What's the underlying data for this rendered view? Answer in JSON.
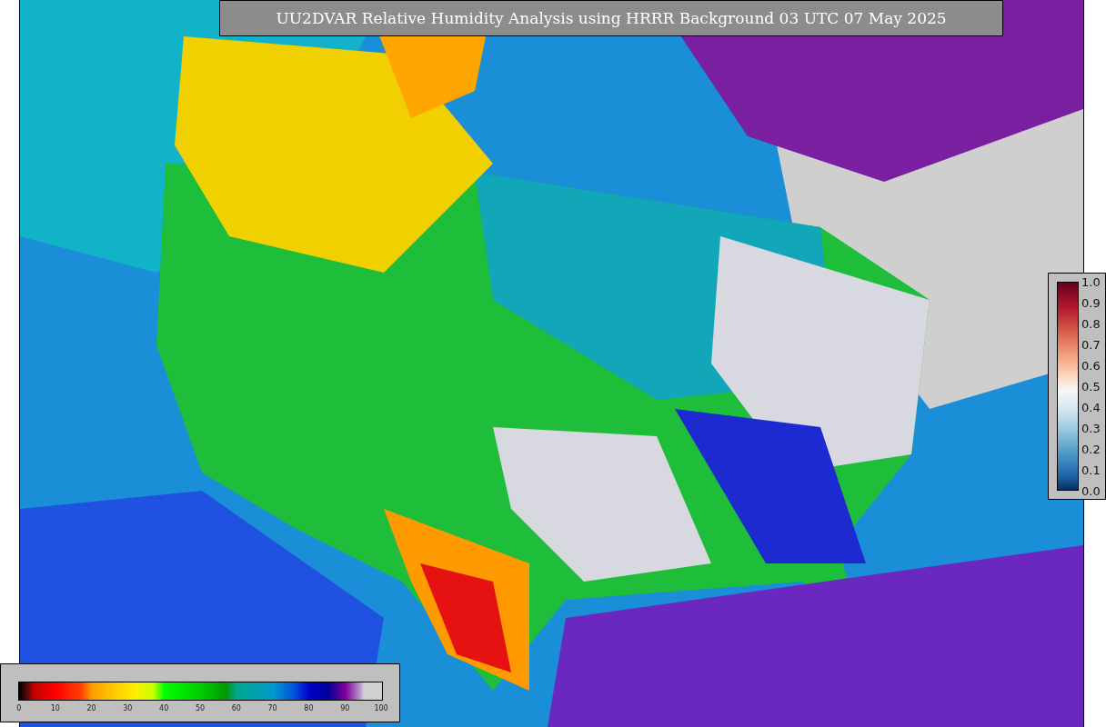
{
  "title": "UU2DVAR Relative Humidity Analysis using HRRR Background 03 UTC 07 May 2025",
  "observation_colorbar": {
    "ticks": [
      "1.0",
      "0.9",
      "0.8",
      "0.7",
      "0.6",
      "0.5",
      "0.4",
      "0.3",
      "0.2",
      "0.1",
      "0.0"
    ]
  },
  "humidity_colorbar": {
    "ticks": [
      "0",
      "10",
      "20",
      "30",
      "40",
      "50",
      "60",
      "70",
      "80",
      "90",
      "100"
    ]
  }
}
